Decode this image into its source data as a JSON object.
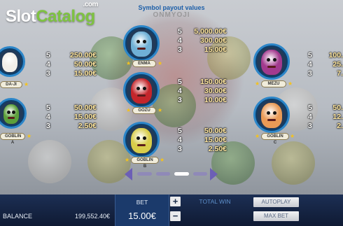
{
  "brand": {
    "logo_slot": "Slot",
    "logo_catalog": "Catalog",
    "logo_com": ".com"
  },
  "header": {
    "title": "Symbol payout values",
    "game_logo": "ONMYOJI"
  },
  "symbols": [
    {
      "name": "DA-JI",
      "color": "#f3efe9",
      "payouts": [
        {
          "count": "5",
          "value": "250.00€"
        },
        {
          "count": "4",
          "value": "50.00€"
        },
        {
          "count": "3",
          "value": "15.00€"
        }
      ]
    },
    {
      "name": "ENMA",
      "color": "#6fb0d6",
      "payouts": [
        {
          "count": "5",
          "value": "5,000.00€"
        },
        {
          "count": "4",
          "value": "300.00€"
        },
        {
          "count": "3",
          "value": "15.00€"
        }
      ]
    },
    {
      "name": "MEZU",
      "color": "#a23a8e",
      "payouts": [
        {
          "count": "5",
          "value": "100."
        },
        {
          "count": "4",
          "value": "25."
        },
        {
          "count": "3",
          "value": "7."
        }
      ]
    },
    {
      "name": "GOZU",
      "color": "#c4262b",
      "payouts": [
        {
          "count": "5",
          "value": "150.00€"
        },
        {
          "count": "4",
          "value": "30.00€"
        },
        {
          "count": "3",
          "value": "10.00€"
        }
      ]
    },
    {
      "name": "GOBLIN A",
      "color": "#5c9f3b",
      "payouts": [
        {
          "count": "5",
          "value": "50.00€"
        },
        {
          "count": "4",
          "value": "15.00€"
        },
        {
          "count": "3",
          "value": "2.50€"
        }
      ]
    },
    {
      "name": "GOBLIN C",
      "color": "#e99a56",
      "payouts": [
        {
          "count": "5",
          "value": "50."
        },
        {
          "count": "4",
          "value": "12."
        },
        {
          "count": "3",
          "value": "2."
        }
      ]
    },
    {
      "name": "GOBLIN B",
      "color": "#d8cd4a",
      "payouts": [
        {
          "count": "5",
          "value": "50.00€"
        },
        {
          "count": "4",
          "value": "15.00€"
        },
        {
          "count": "3",
          "value": "2.50€"
        }
      ]
    }
  ],
  "footer": {
    "balance_label": "BALANCE",
    "balance_value": "199,552.40€",
    "bet_label": "BET",
    "bet_value": "15.00€",
    "plus": "+",
    "minus": "−",
    "total_win_label": "TOTAL WIN",
    "autoplay": "AUTOPLAY",
    "max_bet": "MAX BET"
  },
  "pager": {
    "pages": 4,
    "active_page": 3
  }
}
